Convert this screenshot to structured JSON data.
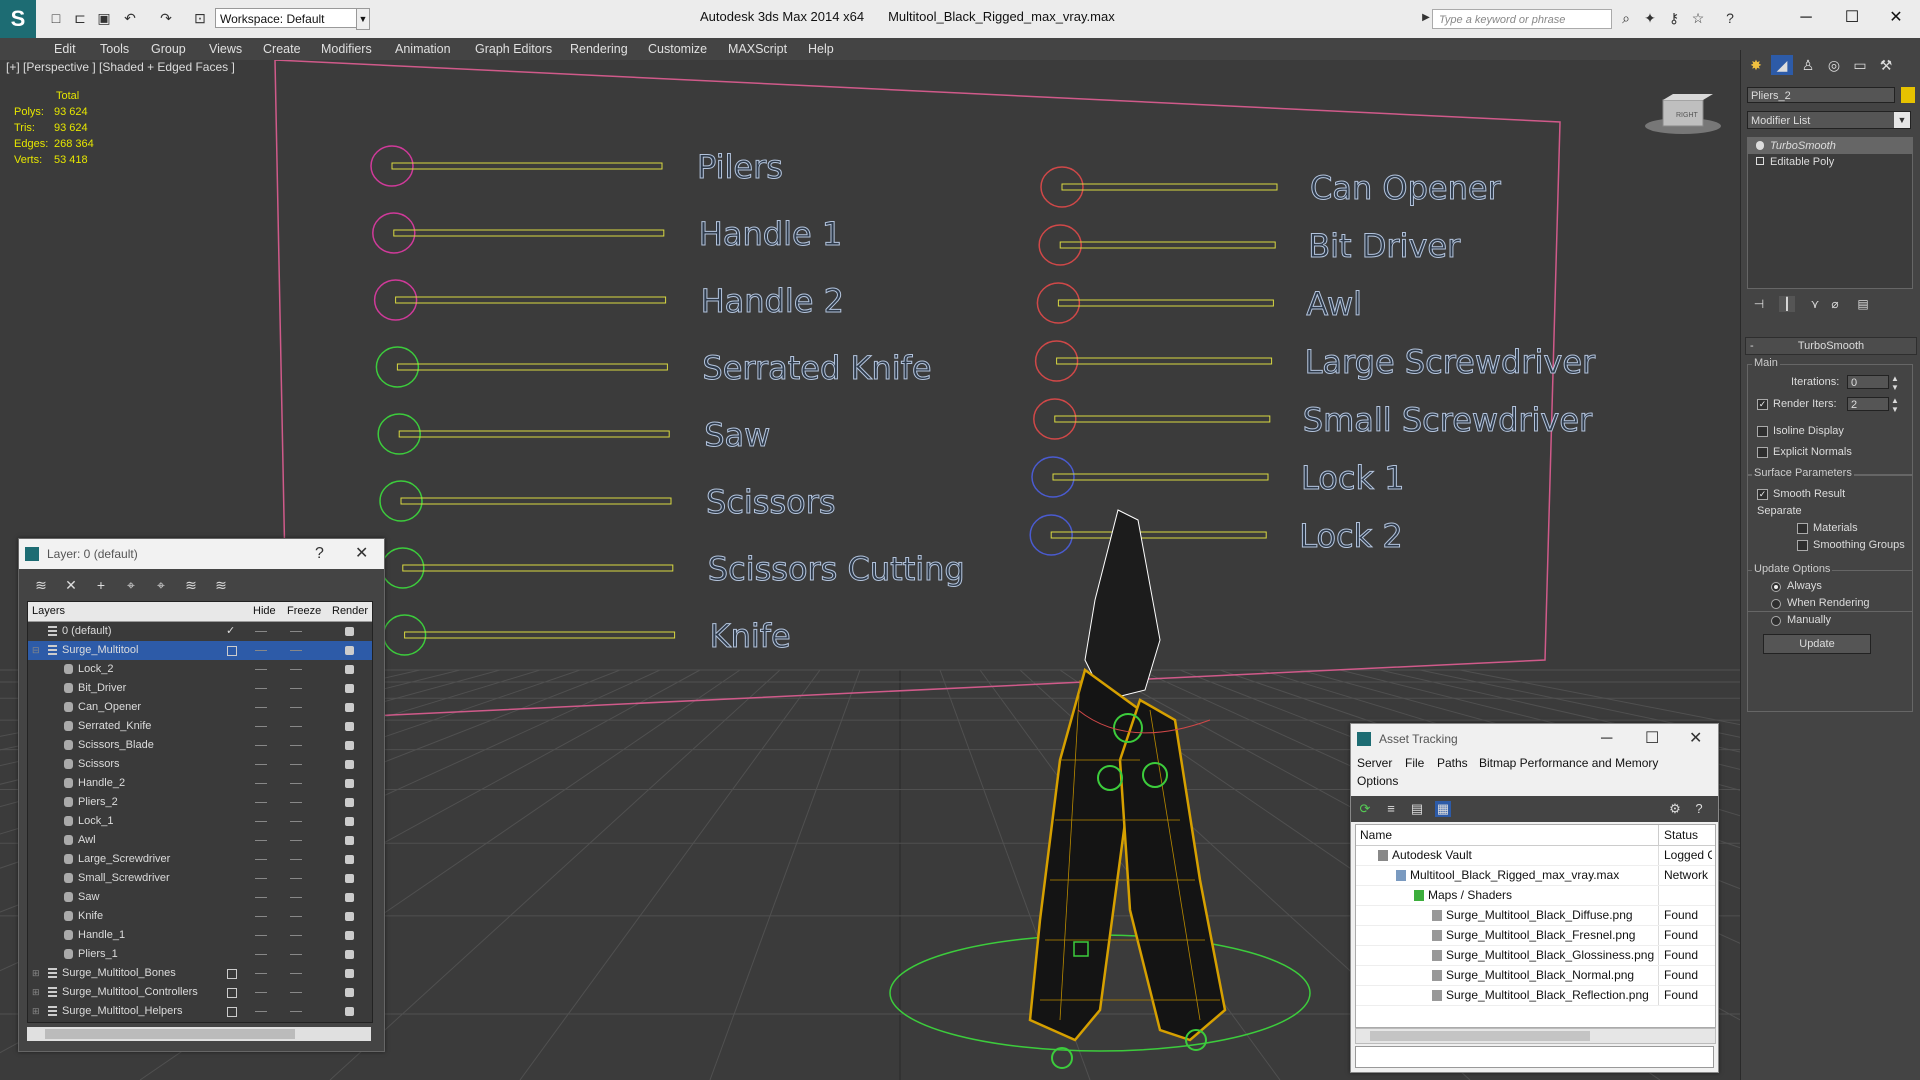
{
  "app": {
    "title": "Autodesk 3ds Max 2014 x64",
    "file": "Multitool_Black_Rigged_max_vray.max",
    "workspace": "Workspace: Default",
    "search_placeholder": "Type a keyword or phrase"
  },
  "menu": [
    "Edit",
    "Tools",
    "Group",
    "Views",
    "Create",
    "Modifiers",
    "Animation",
    "Graph Editors",
    "Rendering",
    "Customize",
    "MAXScript",
    "Help"
  ],
  "viewport": {
    "label": "[+] [Perspective ] [Shaded + Edged Faces ]",
    "stats": {
      "total_label": "Total",
      "polys_label": "Polys:",
      "polys": "93 624",
      "tris_label": "Tris:",
      "tris": "93 624",
      "edges_label": "Edges:",
      "edges": "268 364",
      "verts_label": "Verts:",
      "verts": "53 418"
    },
    "controls_left": [
      "Pilers",
      "Handle 1",
      "Handle 2",
      "Serrated Knife",
      "Saw",
      "Scissors",
      "Scissors Cutting",
      "Knife"
    ],
    "controls_right": [
      "Can Opener",
      "Bit Driver",
      "Awl",
      "Large Screwdriver",
      "Small Screwdriver",
      "Lock 1",
      "Lock 2"
    ],
    "viewcube_label": "RIGHT",
    "colors": {
      "pink": "#d03a9a",
      "green": "#3ccc3c",
      "red": "#d04848",
      "blue": "#4a5bd0",
      "slider": "#d8d840",
      "text": "#b4c4dc",
      "frame": "#d05a8a"
    }
  },
  "layer_window": {
    "title": "Layer: 0 (default)",
    "help": "?",
    "columns": {
      "layers": "Layers",
      "hide": "Hide",
      "freeze": "Freeze",
      "render": "Render"
    },
    "rows": [
      {
        "name": "0 (default)",
        "level": 1,
        "type": "layer",
        "current": true
      },
      {
        "name": "Surge_Multitool",
        "level": 1,
        "type": "layer",
        "selected": true,
        "box": true
      },
      {
        "name": "Lock_2",
        "level": 2,
        "type": "object"
      },
      {
        "name": "Bit_Driver",
        "level": 2,
        "type": "object"
      },
      {
        "name": "Can_Opener",
        "level": 2,
        "type": "object"
      },
      {
        "name": "Serrated_Knife",
        "level": 2,
        "type": "object"
      },
      {
        "name": "Scissors_Blade",
        "level": 2,
        "type": "object"
      },
      {
        "name": "Scissors",
        "level": 2,
        "type": "object"
      },
      {
        "name": "Handle_2",
        "level": 2,
        "type": "object"
      },
      {
        "name": "Pliers_2",
        "level": 2,
        "type": "object"
      },
      {
        "name": "Lock_1",
        "level": 2,
        "type": "object"
      },
      {
        "name": "Awl",
        "level": 2,
        "type": "object"
      },
      {
        "name": "Large_Screwdriver",
        "level": 2,
        "type": "object"
      },
      {
        "name": "Small_Screwdriver",
        "level": 2,
        "type": "object"
      },
      {
        "name": "Saw",
        "level": 2,
        "type": "object"
      },
      {
        "name": "Knife",
        "level": 2,
        "type": "object"
      },
      {
        "name": "Handle_1",
        "level": 2,
        "type": "object"
      },
      {
        "name": "Pliers_1",
        "level": 2,
        "type": "object"
      },
      {
        "name": "Surge_Multitool_Bones",
        "level": 1,
        "type": "layer",
        "box": true,
        "collapsed": true
      },
      {
        "name": "Surge_Multitool_Controllers",
        "level": 1,
        "type": "layer",
        "box": true,
        "collapsed": true
      },
      {
        "name": "Surge_Multitool_Helpers",
        "level": 1,
        "type": "layer",
        "box": true,
        "collapsed": true
      }
    ]
  },
  "asset_window": {
    "title": "Asset Tracking",
    "menu": [
      "Server",
      "File",
      "Paths",
      "Bitmap Performance and Memory",
      "Options"
    ],
    "columns": {
      "name": "Name",
      "status": "Status"
    },
    "rows": [
      {
        "name": "Autodesk Vault",
        "status": "Logged Out",
        "level": 1,
        "icon": "vault"
      },
      {
        "name": "Multitool_Black_Rigged_max_vray.max",
        "status": "Network",
        "level": 2,
        "icon": "max"
      },
      {
        "name": "Maps / Shaders",
        "status": "",
        "level": 3,
        "icon": "maps"
      },
      {
        "name": "Surge_Multitool_Black_Diffuse.png",
        "status": "Found",
        "level": 4,
        "icon": "image"
      },
      {
        "name": "Surge_Multitool_Black_Fresnel.png",
        "status": "Found",
        "level": 4,
        "icon": "image"
      },
      {
        "name": "Surge_Multitool_Black_Glossiness.png",
        "status": "Found",
        "level": 4,
        "icon": "image"
      },
      {
        "name": "Surge_Multitool_Black_Normal.png",
        "status": "Found",
        "level": 4,
        "icon": "image"
      },
      {
        "name": "Surge_Multitool_Black_Reflection.png",
        "status": "Found",
        "level": 4,
        "icon": "image"
      }
    ]
  },
  "command_panel": {
    "object_name": "Pliers_2",
    "object_color": "#e6c200",
    "modifier_list": "Modifier List",
    "stack": [
      "TurboSmooth",
      "Editable Poly"
    ],
    "rollout_title": "TurboSmooth",
    "main_label": "Main",
    "iterations_label": "Iterations:",
    "iterations": "0",
    "render_iters_label": "Render Iters:",
    "render_iters": "2",
    "render_iters_checked": true,
    "isoline_label": "Isoline Display",
    "explicit_label": "Explicit Normals",
    "surface_label": "Surface Parameters",
    "smooth_result_label": "Smooth Result",
    "smooth_result_checked": true,
    "separate_label": "Separate",
    "materials_label": "Materials",
    "smoothing_groups_label": "Smoothing Groups",
    "update_options_label": "Update Options",
    "always_label": "Always",
    "when_rendering_label": "When Rendering",
    "manually_label": "Manually",
    "update_button": "Update"
  }
}
